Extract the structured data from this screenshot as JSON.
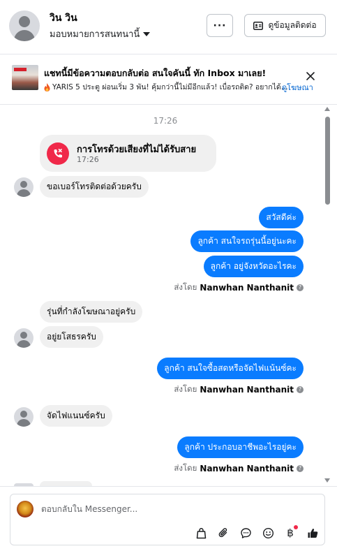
{
  "header": {
    "contact_name": "วิน วิน",
    "assign_label": "มอบหมายการสนทนานี้",
    "more_label": "···",
    "contact_info_label": "ดูข้อมูลติดต่อ"
  },
  "ad": {
    "title": "แชทนี้มีข้อความตอบกลับต่อ สนใจคันนี้ ทัก Inbox มาเลย!",
    "subtitle": "YARIS 5 ประตู ผ่อนเริ่ม 3 พัน! คุ้มกว่านี้ไม่มีอีกแล้ว! เบื่อรถติด? อยากได้...",
    "link": "ดูโฆษณา"
  },
  "chat": {
    "timestamp": "17:26",
    "missed_call": {
      "title": "การโทรด้วยเสียงที่ไม่ได้รับสาย",
      "time": "17:26"
    },
    "messages": [
      {
        "dir": "in",
        "text": "ขอเบอร์โทรติดต่อด้วยครับ",
        "avatar": true
      },
      {
        "dir": "out",
        "text": "สวัสดีค่ะ"
      },
      {
        "dir": "out",
        "text": "ลูกค้า สนใจรถรุ่นนี้อยู่นะคะ"
      },
      {
        "dir": "out",
        "text": "ลูกค้า อยู่จังหวัดอะไรคะ"
      },
      {
        "dir": "in",
        "text": "รุ่นที่กำลังโฆษณาอยู่ครับ",
        "avatar": false
      },
      {
        "dir": "in",
        "text": "อยู่ยโสธรครับ",
        "avatar": true
      },
      {
        "dir": "out",
        "text": "ลูกค้า สนใจซื้อสดหรือจัดไฟแน้นซ์คะ"
      },
      {
        "dir": "in",
        "text": "จัดไฟแนนซ์ครับ",
        "avatar": true
      },
      {
        "dir": "out",
        "text": "ลูกค้า ประกอบอาชีพอะไรอยู่คะ"
      }
    ],
    "sent_by_prefix": "ส่งโดย",
    "sent_by_name": "Nanwhan Nanthanit"
  },
  "composer": {
    "placeholder": "ตอบกลับใน Messenger...",
    "tools": [
      "bag-icon",
      "paperclip-icon",
      "chat-bubble-icon",
      "smile-icon",
      "baht-icon",
      "thumbs-up-icon"
    ],
    "baht_symbol": "฿"
  },
  "colors": {
    "accent": "#0a7cff",
    "incoming_bubble": "#f0f0f0",
    "missed_call": "#f02849",
    "link": "#0064d1"
  }
}
